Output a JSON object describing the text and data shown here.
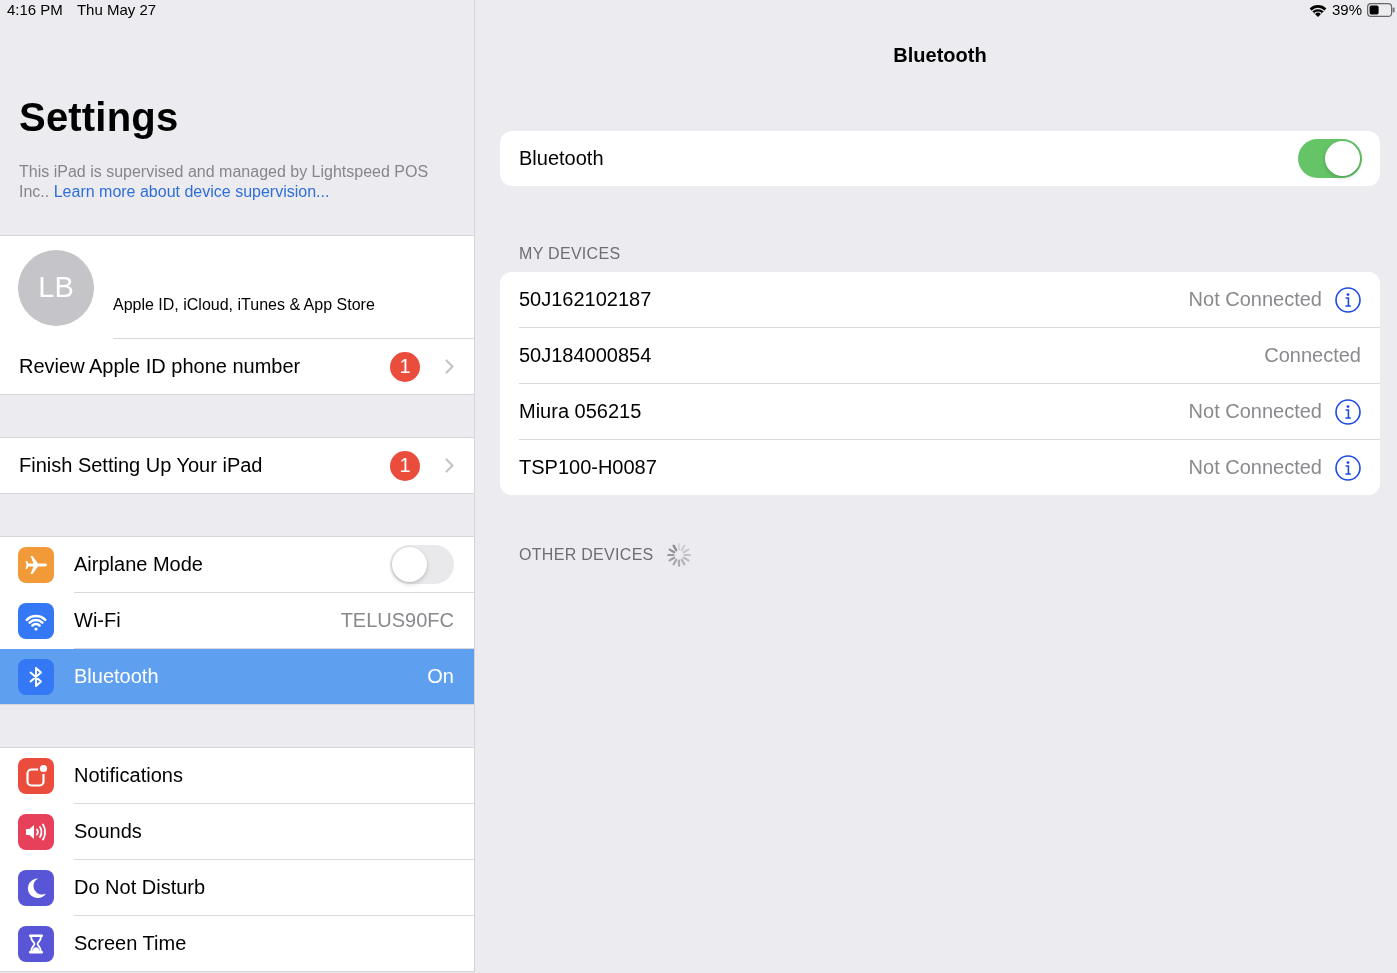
{
  "status_bar": {
    "time": "4:16 PM",
    "date": "Thu May 27",
    "battery": "39%"
  },
  "sidebar": {
    "title": "Settings",
    "supervision_note": "This iPad is supervised and managed by Lightspeed POS Inc..",
    "supervision_link": "Learn more about device supervision...",
    "groups": [
      {
        "items": [
          {
            "kind": "profile",
            "initials": "LB",
            "label": "Apple ID, iCloud, iTunes & App Store",
            "selected": false
          },
          {
            "kind": "alert",
            "label": "Review Apple ID phone number",
            "badge": "1",
            "selected": false
          }
        ]
      },
      {
        "items": [
          {
            "kind": "alert",
            "label": "Finish Setting Up Your iPad",
            "badge": "1",
            "selected": false
          }
        ]
      },
      {
        "items": [
          {
            "kind": "toggle",
            "label": "Airplane Mode",
            "on": false,
            "selected": false
          },
          {
            "kind": "value",
            "label": "Wi-Fi",
            "value": "TELUS90FC",
            "selected": false
          },
          {
            "kind": "value",
            "label": "Bluetooth",
            "value": "On",
            "selected": true
          }
        ]
      },
      {
        "items": [
          {
            "kind": "link",
            "label": "Notifications",
            "selected": false
          },
          {
            "kind": "link",
            "label": "Sounds",
            "selected": false
          },
          {
            "kind": "link",
            "label": "Do Not Disturb",
            "selected": false
          },
          {
            "kind": "link",
            "label": "Screen Time",
            "selected": false
          }
        ]
      }
    ]
  },
  "detail": {
    "title": "Bluetooth",
    "toggle": {
      "label": "Bluetooth",
      "on": true
    },
    "sections": [
      {
        "header": "MY DEVICES",
        "devices": [
          {
            "name": "50J162102187",
            "status": "Not Connected",
            "info": true
          },
          {
            "name": "50J184000854",
            "status": "Connected",
            "info": false
          },
          {
            "name": "Miura 056215",
            "status": "Not Connected",
            "info": true
          },
          {
            "name": "TSP100-H0087",
            "status": "Not Connected",
            "info": true
          }
        ]
      },
      {
        "header": "OTHER DEVICES",
        "searching": true
      }
    ]
  }
}
